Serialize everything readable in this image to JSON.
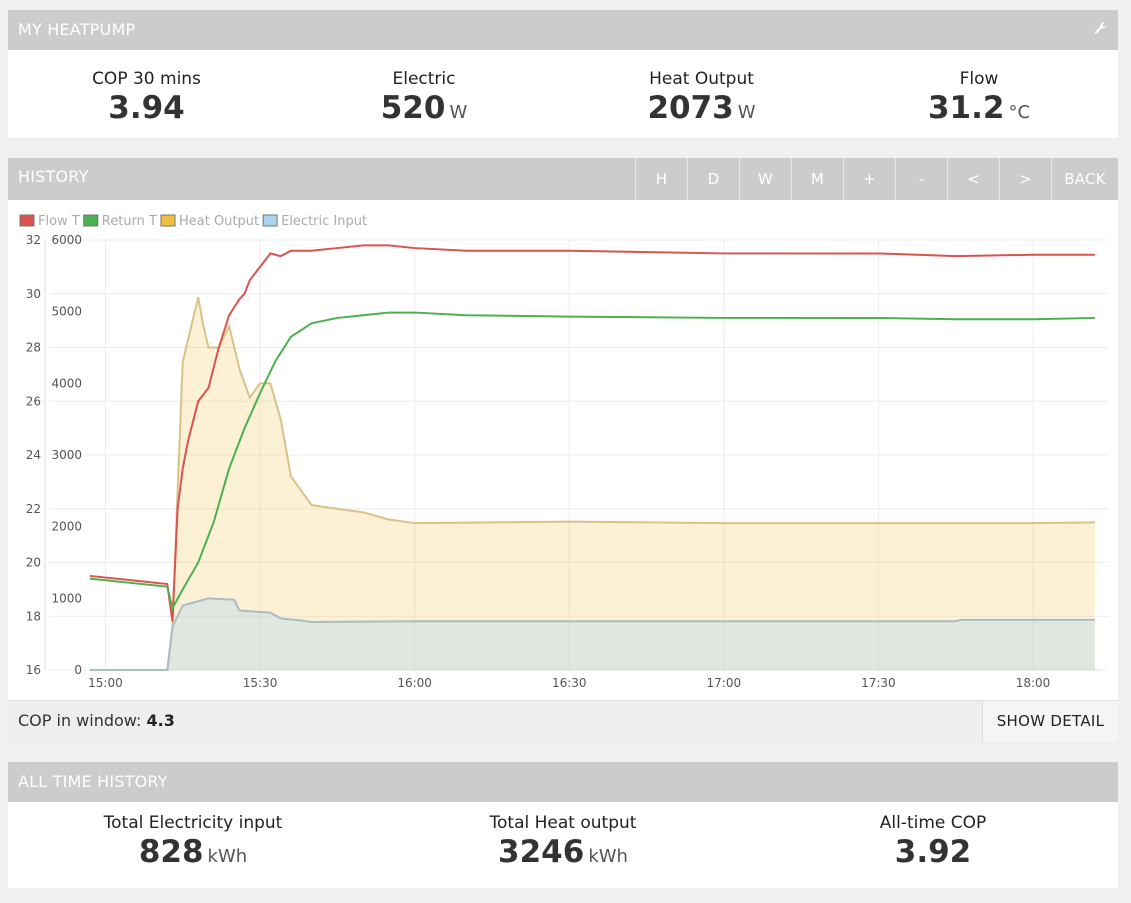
{
  "heatpump": {
    "title": "MY HEATPUMP",
    "stats": [
      {
        "label": "COP 30 mins",
        "value": "3.94",
        "unit": ""
      },
      {
        "label": "Electric",
        "value": "520",
        "unit": "W"
      },
      {
        "label": "Heat Output",
        "value": "2073",
        "unit": "W"
      },
      {
        "label": "Flow",
        "value": "31.2",
        "unit": "°C"
      }
    ]
  },
  "history": {
    "title": "HISTORY",
    "buttons": [
      "H",
      "D",
      "W",
      "M",
      "+",
      "-",
      "<",
      ">",
      "BACK"
    ],
    "cop_label": "COP in window:",
    "cop_value": "4.3",
    "show_detail": "SHOW DETAIL"
  },
  "all_time": {
    "title": "ALL TIME HISTORY",
    "stats": [
      {
        "label": "Total Electricity input",
        "value": "828",
        "unit": "kWh"
      },
      {
        "label": "Total Heat output",
        "value": "3246",
        "unit": "kWh"
      },
      {
        "label": "All-time COP",
        "value": "3.92",
        "unit": ""
      }
    ]
  },
  "chart_data": {
    "type": "line",
    "legend": [
      {
        "name": "Flow T",
        "color": "#d9534f"
      },
      {
        "name": "Return T",
        "color": "#4caf50"
      },
      {
        "name": "Heat Output",
        "color": "#f0c040"
      },
      {
        "name": "Electric Input",
        "color": "#a8d4f0"
      }
    ],
    "legend_position": "top-left",
    "grid": true,
    "x_ticks": [
      "15:00",
      "15:30",
      "16:00",
      "16:30",
      "17:00",
      "17:30",
      "18:00"
    ],
    "x_range": [
      "14:57",
      "18:13"
    ],
    "y_left_ticks": [
      "32",
      "30",
      "28",
      "26",
      "24",
      "22",
      "20",
      "18",
      "16"
    ],
    "y_left_range": [
      16,
      32
    ],
    "y_right_ticks": [
      "6000",
      "5000",
      "4000",
      "3000",
      "2000",
      "1000",
      "0"
    ],
    "y_right_range": [
      0,
      6000
    ],
    "series": [
      {
        "name": "Flow T",
        "axis": "left",
        "style": "line",
        "color": "#d9534f",
        "points": [
          [
            "14:57",
            19.5
          ],
          [
            "15:12",
            19.2
          ],
          [
            "15:13",
            17.8
          ],
          [
            "15:14",
            22.0
          ],
          [
            "15:15",
            23.5
          ],
          [
            "15:16",
            24.5
          ],
          [
            "15:18",
            26.0
          ],
          [
            "15:20",
            26.5
          ],
          [
            "15:22",
            28.0
          ],
          [
            "15:24",
            29.2
          ],
          [
            "15:26",
            29.8
          ],
          [
            "15:27",
            30.0
          ],
          [
            "15:28",
            30.5
          ],
          [
            "15:30",
            31.0
          ],
          [
            "15:32",
            31.5
          ],
          [
            "15:34",
            31.4
          ],
          [
            "15:36",
            31.6
          ],
          [
            "15:40",
            31.6
          ],
          [
            "15:45",
            31.7
          ],
          [
            "15:50",
            31.8
          ],
          [
            "15:55",
            31.8
          ],
          [
            "16:00",
            31.7
          ],
          [
            "16:10",
            31.6
          ],
          [
            "16:30",
            31.6
          ],
          [
            "17:00",
            31.5
          ],
          [
            "17:30",
            31.5
          ],
          [
            "17:45",
            31.4
          ],
          [
            "18:00",
            31.45
          ],
          [
            "18:12",
            31.45
          ]
        ]
      },
      {
        "name": "Return T",
        "axis": "left",
        "style": "line",
        "color": "#4caf50",
        "points": [
          [
            "14:57",
            19.4
          ],
          [
            "15:12",
            19.1
          ],
          [
            "15:13",
            18.3
          ],
          [
            "15:15",
            19.0
          ],
          [
            "15:18",
            20.0
          ],
          [
            "15:21",
            21.5
          ],
          [
            "15:24",
            23.5
          ],
          [
            "15:27",
            25.0
          ],
          [
            "15:30",
            26.3
          ],
          [
            "15:33",
            27.5
          ],
          [
            "15:36",
            28.4
          ],
          [
            "15:40",
            28.9
          ],
          [
            "15:45",
            29.1
          ],
          [
            "15:50",
            29.2
          ],
          [
            "15:55",
            29.3
          ],
          [
            "16:00",
            29.3
          ],
          [
            "16:10",
            29.2
          ],
          [
            "16:30",
            29.15
          ],
          [
            "17:00",
            29.1
          ],
          [
            "17:30",
            29.1
          ],
          [
            "17:45",
            29.05
          ],
          [
            "18:00",
            29.05
          ],
          [
            "18:12",
            29.1
          ]
        ]
      },
      {
        "name": "Heat Output",
        "axis": "right",
        "style": "area",
        "color": "#f0c040",
        "points": [
          [
            "14:57",
            0
          ],
          [
            "15:12",
            0
          ],
          [
            "15:13",
            600
          ],
          [
            "15:14",
            2500
          ],
          [
            "15:15",
            4300
          ],
          [
            "15:16",
            4600
          ],
          [
            "15:17",
            4900
          ],
          [
            "15:18",
            5200
          ],
          [
            "15:19",
            4800
          ],
          [
            "15:20",
            4500
          ],
          [
            "15:22",
            4500
          ],
          [
            "15:24",
            4800
          ],
          [
            "15:26",
            4200
          ],
          [
            "15:28",
            3800
          ],
          [
            "15:30",
            4000
          ],
          [
            "15:32",
            4000
          ],
          [
            "15:34",
            3500
          ],
          [
            "15:36",
            2700
          ],
          [
            "15:38",
            2500
          ],
          [
            "15:40",
            2300
          ],
          [
            "15:45",
            2250
          ],
          [
            "15:50",
            2200
          ],
          [
            "15:55",
            2100
          ],
          [
            "16:00",
            2050
          ],
          [
            "16:30",
            2070
          ],
          [
            "17:00",
            2050
          ],
          [
            "17:30",
            2050
          ],
          [
            "18:00",
            2050
          ],
          [
            "18:12",
            2060
          ]
        ]
      },
      {
        "name": "Electric Input",
        "axis": "right",
        "style": "area",
        "color": "#a8d4f0",
        "points": [
          [
            "14:57",
            0
          ],
          [
            "15:12",
            0
          ],
          [
            "15:13",
            600
          ],
          [
            "15:15",
            900
          ],
          [
            "15:20",
            1000
          ],
          [
            "15:25",
            980
          ],
          [
            "15:26",
            830
          ],
          [
            "15:32",
            800
          ],
          [
            "15:34",
            720
          ],
          [
            "15:38",
            690
          ],
          [
            "15:40",
            670
          ],
          [
            "16:00",
            680
          ],
          [
            "17:00",
            680
          ],
          [
            "17:45",
            680
          ],
          [
            "17:46",
            700
          ],
          [
            "18:12",
            700
          ]
        ]
      }
    ]
  }
}
